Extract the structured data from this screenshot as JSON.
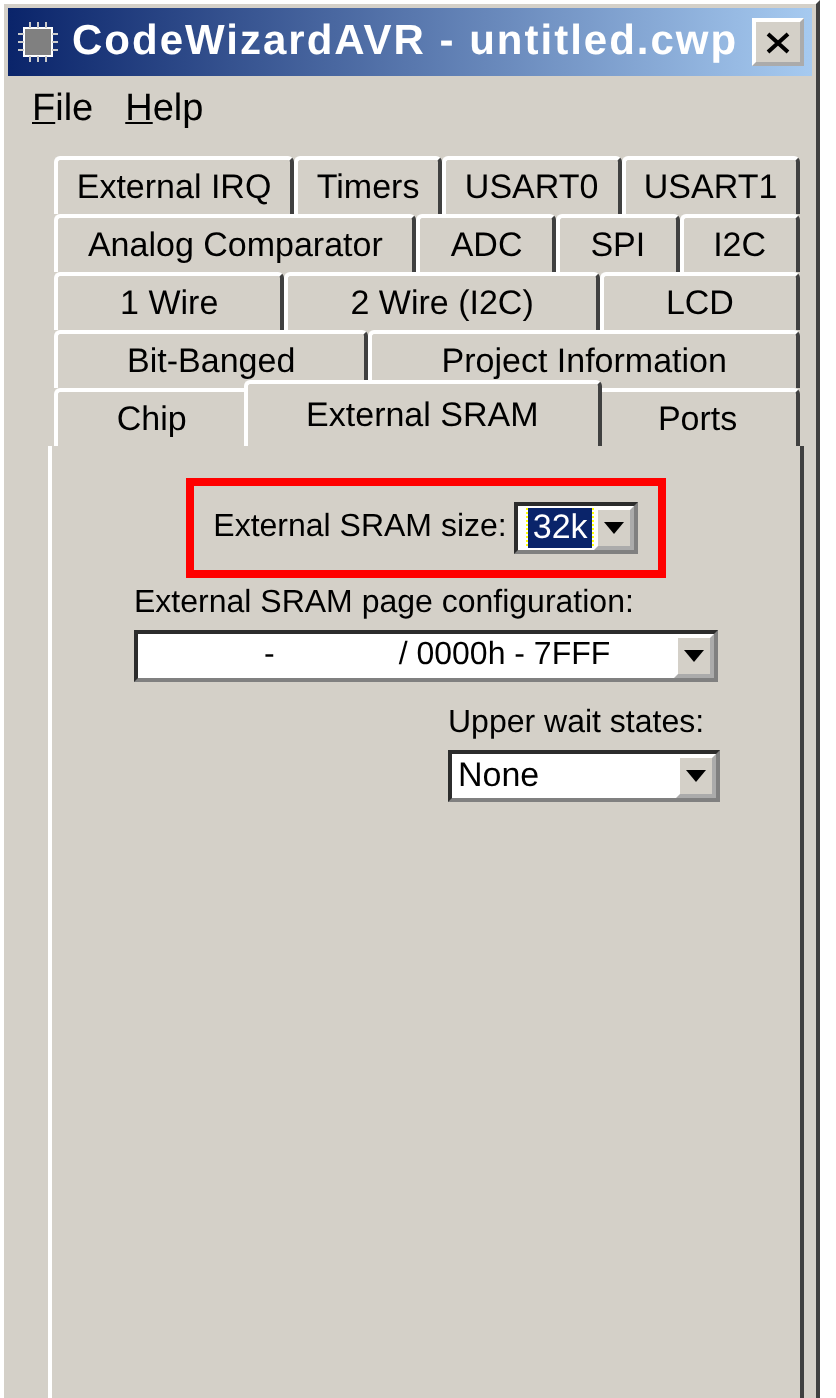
{
  "window": {
    "title": "CodeWizardAVR - untitled.cwp"
  },
  "menu": [
    {
      "mnemonic": "F",
      "rest": "ile"
    },
    {
      "mnemonic": "H",
      "rest": "elp"
    }
  ],
  "tab_rows": [
    [
      {
        "label": "External IRQ",
        "selected": false
      },
      {
        "label": "Timers",
        "selected": false
      },
      {
        "label": "USART0",
        "selected": false
      },
      {
        "label": "USART1",
        "selected": false
      }
    ],
    [
      {
        "label": "Analog Comparator",
        "selected": false
      },
      {
        "label": "ADC",
        "selected": false
      },
      {
        "label": "SPI",
        "selected": false
      },
      {
        "label": "I2C",
        "selected": false
      }
    ],
    [
      {
        "label": "1 Wire",
        "selected": false
      },
      {
        "label": "2 Wire (I2C)",
        "selected": false
      },
      {
        "label": "LCD",
        "selected": false
      }
    ],
    [
      {
        "label": "Bit-Banged",
        "selected": false
      },
      {
        "label": "Project Information",
        "selected": false
      }
    ],
    [
      {
        "label": "Chip",
        "selected": false
      },
      {
        "label": "External SRAM",
        "selected": true
      },
      {
        "label": "Ports",
        "selected": false
      }
    ]
  ],
  "sram_size": {
    "label": "External SRAM size:",
    "value": "32k",
    "highlighted": true
  },
  "page_config": {
    "label": "External SRAM page configuration:",
    "value_parts": [
      "-",
      "/ 0000h - 7FFF"
    ]
  },
  "wait_states": {
    "label": "Upper wait states:",
    "value": "None"
  }
}
